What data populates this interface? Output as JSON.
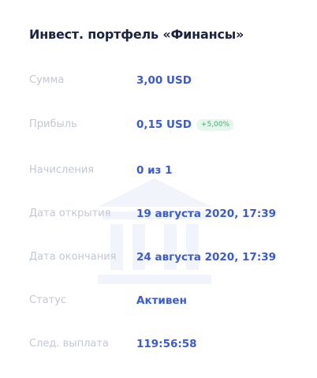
{
  "card": {
    "title": "Инвест. портфель «Финансы»",
    "watermark_icon": "bank-icon"
  },
  "rows": [
    {
      "label": "Сумма",
      "value": "3,00 USD"
    },
    {
      "label": "Прибыль",
      "value": "0,15 USD",
      "badge": "+5,00%"
    },
    {
      "label": "Начисления",
      "value": "0 из 1"
    },
    {
      "label": "Дата открытия",
      "value": "19 августа 2020, 17:39"
    },
    {
      "label": "Дата окончания",
      "value": "24 августа 2020, 17:39"
    },
    {
      "label": "Статус",
      "value": "Активен"
    },
    {
      "label": "След. выплата",
      "value": "119:56:58"
    }
  ],
  "colors": {
    "accent": "#3a5bd6",
    "title": "#1c2340",
    "label": "#c3c7d6",
    "badge_text": "#3cb371",
    "badge_bg": "#e6f7ee"
  }
}
